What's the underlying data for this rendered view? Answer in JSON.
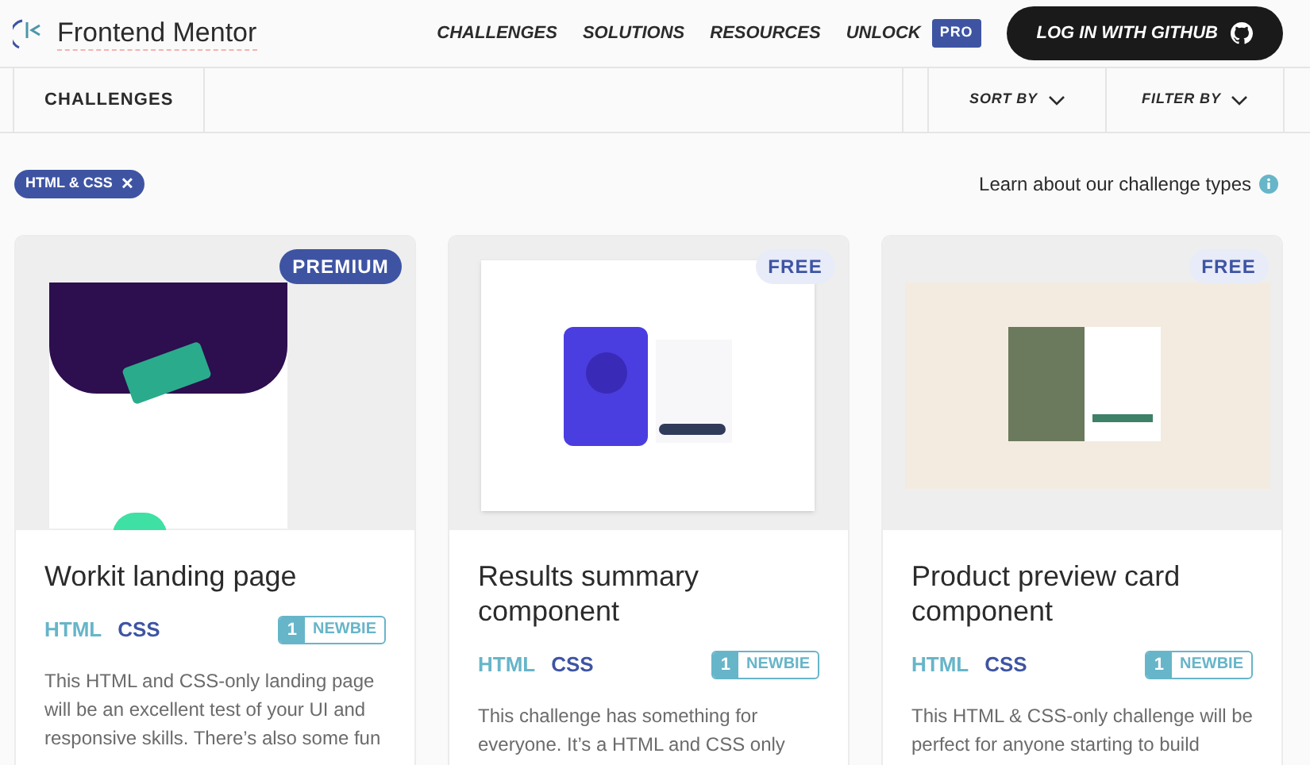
{
  "header": {
    "logo_text": "Frontend Mentor",
    "nav": [
      "CHALLENGES",
      "SOLUTIONS",
      "RESOURCES",
      "UNLOCK"
    ],
    "pro_badge": "PRO",
    "login_button": "LOG IN WITH GITHUB"
  },
  "toolbar": {
    "title": "CHALLENGES",
    "sort": "SORT BY",
    "filter": "FILTER BY"
  },
  "active_filter": {
    "label": "HTML & CSS",
    "remove": "✕"
  },
  "learn_link": "Learn about our challenge types",
  "cards": [
    {
      "badge": {
        "kind": "premium",
        "label": "PREMIUM"
      },
      "kind": "landing",
      "title": "Workit landing page",
      "tags": [
        "HTML",
        "CSS"
      ],
      "level_number": "1",
      "level_label": "NEWBIE",
      "description": "This HTML and CSS-only landing page will be an excellent test of your UI and responsive skills. There’s also some fun"
    },
    {
      "badge": {
        "kind": "free",
        "label": "FREE"
      },
      "kind": "results",
      "title": "Results summary component",
      "tags": [
        "HTML",
        "CSS"
      ],
      "level_number": "1",
      "level_label": "NEWBIE",
      "description": "This challenge has something for everyone. It’s a HTML and CSS only"
    },
    {
      "badge": {
        "kind": "free",
        "label": "FREE"
      },
      "kind": "product",
      "title": "Product preview card component",
      "tags": [
        "HTML",
        "CSS"
      ],
      "level_number": "1",
      "level_label": "NEWBIE",
      "description": "This HTML & CSS-only challenge will be perfect for anyone starting to build"
    }
  ]
}
